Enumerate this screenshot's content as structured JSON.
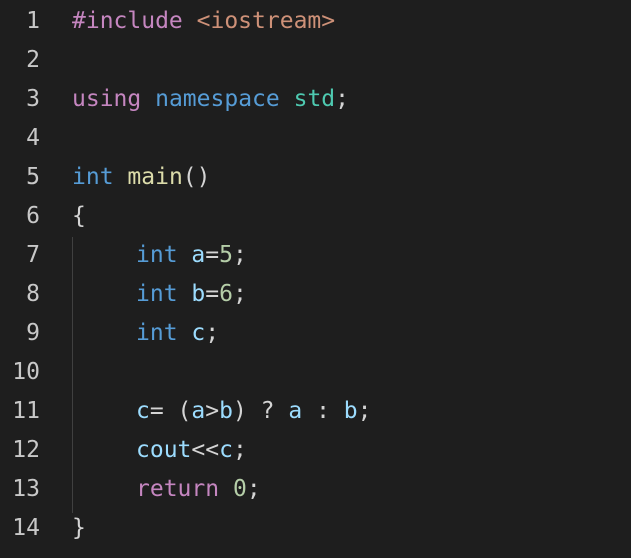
{
  "editor": {
    "lines": [
      {
        "number": "1",
        "tokens": [
          {
            "t": "#include",
            "c": "t-pre"
          },
          {
            "t": " ",
            "c": "t-op"
          },
          {
            "t": "<iostream>",
            "c": "t-inc"
          }
        ]
      },
      {
        "number": "2",
        "tokens": []
      },
      {
        "number": "3",
        "tokens": [
          {
            "t": "using",
            "c": "t-ctl"
          },
          {
            "t": " ",
            "c": "t-op"
          },
          {
            "t": "namespace",
            "c": "t-kw"
          },
          {
            "t": " ",
            "c": "t-op"
          },
          {
            "t": "std",
            "c": "t-ns"
          },
          {
            "t": ";",
            "c": "t-op"
          }
        ]
      },
      {
        "number": "4",
        "tokens": []
      },
      {
        "number": "5",
        "tokens": [
          {
            "t": "int",
            "c": "t-kw"
          },
          {
            "t": " ",
            "c": "t-op"
          },
          {
            "t": "main",
            "c": "t-fn"
          },
          {
            "t": "()",
            "c": "t-op"
          }
        ]
      },
      {
        "number": "6",
        "tokens": [
          {
            "t": "{",
            "c": "t-op"
          }
        ]
      },
      {
        "number": "7",
        "indent": true,
        "tokens": [
          {
            "t": "int",
            "c": "t-kw"
          },
          {
            "t": " ",
            "c": "t-op"
          },
          {
            "t": "a",
            "c": "t-var"
          },
          {
            "t": "=",
            "c": "t-op"
          },
          {
            "t": "5",
            "c": "t-num"
          },
          {
            "t": ";",
            "c": "t-op"
          }
        ]
      },
      {
        "number": "8",
        "indent": true,
        "tokens": [
          {
            "t": "int",
            "c": "t-kw"
          },
          {
            "t": " ",
            "c": "t-op"
          },
          {
            "t": "b",
            "c": "t-var"
          },
          {
            "t": "=",
            "c": "t-op"
          },
          {
            "t": "6",
            "c": "t-num"
          },
          {
            "t": ";",
            "c": "t-op"
          }
        ]
      },
      {
        "number": "9",
        "indent": true,
        "tokens": [
          {
            "t": "int",
            "c": "t-kw"
          },
          {
            "t": " ",
            "c": "t-op"
          },
          {
            "t": "c",
            "c": "t-var"
          },
          {
            "t": ";",
            "c": "t-op"
          }
        ]
      },
      {
        "number": "10",
        "tokens": []
      },
      {
        "number": "11",
        "indent": true,
        "tokens": [
          {
            "t": "c",
            "c": "t-var"
          },
          {
            "t": "= (",
            "c": "t-op"
          },
          {
            "t": "a",
            "c": "t-var"
          },
          {
            "t": ">",
            "c": "t-op"
          },
          {
            "t": "b",
            "c": "t-var"
          },
          {
            "t": ") ? ",
            "c": "t-op"
          },
          {
            "t": "a",
            "c": "t-var"
          },
          {
            "t": " : ",
            "c": "t-op"
          },
          {
            "t": "b",
            "c": "t-var"
          },
          {
            "t": ";",
            "c": "t-op"
          }
        ]
      },
      {
        "number": "12",
        "indent": true,
        "tokens": [
          {
            "t": "cout",
            "c": "t-var"
          },
          {
            "t": "<<",
            "c": "t-op"
          },
          {
            "t": "c",
            "c": "t-var"
          },
          {
            "t": ";",
            "c": "t-op"
          }
        ]
      },
      {
        "number": "13",
        "indent": true,
        "tokens": [
          {
            "t": "return",
            "c": "t-ctl"
          },
          {
            "t": " ",
            "c": "t-op"
          },
          {
            "t": "0",
            "c": "t-num"
          },
          {
            "t": ";",
            "c": "t-op"
          }
        ]
      },
      {
        "number": "14",
        "tokens": [
          {
            "t": "}",
            "c": "t-op"
          }
        ]
      }
    ]
  },
  "colors": {
    "background": "#1e1e1e",
    "keyword": "#569cd6",
    "control": "#c586c0",
    "string": "#ce9178",
    "type_namespace": "#4ec9b0",
    "variable": "#9cdcfe",
    "function": "#dcdcaa",
    "number": "#b5cea8"
  }
}
